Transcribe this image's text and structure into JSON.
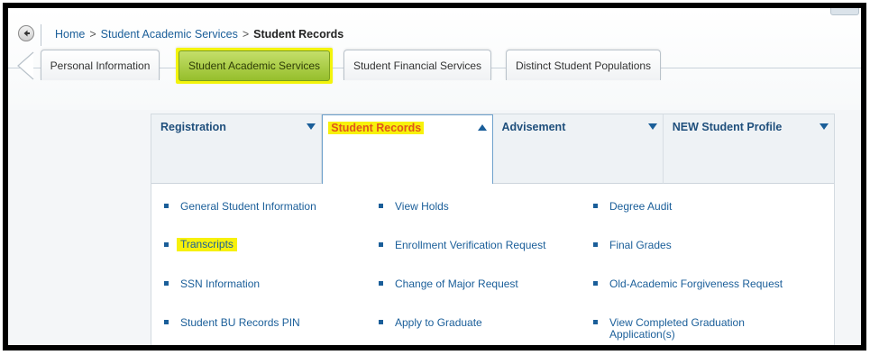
{
  "breadcrumb": {
    "home": "Home",
    "separator": ">",
    "section": "Student Academic Services",
    "current": "Student Records"
  },
  "icons": {
    "back": "back-arrow-icon",
    "tab_scroll_left": "chevron-left-icon",
    "caret_down": "caret-down-icon",
    "caret_up": "caret-up-icon",
    "bullet": "square-bullet-icon"
  },
  "top_tabs": [
    {
      "label": "Personal Information",
      "active": false
    },
    {
      "label": "Student Academic Services",
      "active": true
    },
    {
      "label": "Student Financial Services",
      "active": false
    },
    {
      "label": "Distinct Student Populations",
      "active": false
    }
  ],
  "menu_tabs": [
    {
      "label": "Registration",
      "expanded": false
    },
    {
      "label": "Student Records",
      "expanded": true
    },
    {
      "label": "Advisement",
      "expanded": false
    },
    {
      "label": "NEW Student Profile",
      "expanded": false
    }
  ],
  "links": {
    "col1": [
      "General Student Information",
      "Transcripts",
      "SSN Information",
      "Student BU Records PIN"
    ],
    "col2": [
      "View Holds",
      "Enrollment Verification Request",
      "Change of Major Request",
      "Apply to Graduate"
    ],
    "col3": [
      "Degree Audit",
      "Final Grades",
      "Old-Academic Forgiveness Request",
      "View Completed Graduation Application(s)"
    ]
  },
  "colors": {
    "link": "#1a5e99",
    "highlight": "#f7f10b",
    "active_tab": "#a8cc3c",
    "selected_menu_text": "#e0551b"
  }
}
